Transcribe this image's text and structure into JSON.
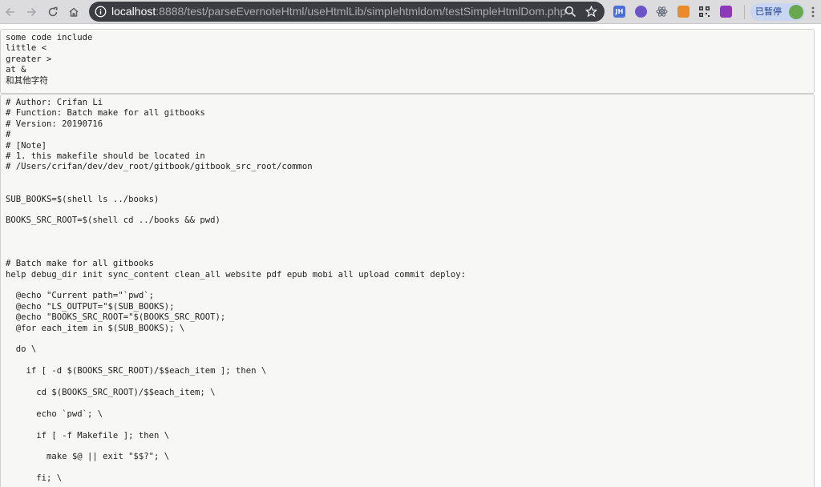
{
  "browser": {
    "url_host": "localhost",
    "url_rest": ":8888/test/parseEvernoteHtml/useHtmlLib/simplehtmldom/testSimpleHtmlDom.php",
    "nav_icons": [
      "back-arrow-icon",
      "forward-arrow-icon",
      "reload-icon",
      "home-icon"
    ],
    "omnibox_icons": [
      "site-info-icon",
      "zoom-search-icon",
      "bookmark-star-icon"
    ],
    "extensions": [
      {
        "name": "jh-extension-icon",
        "label": "JH",
        "color": "#4a6fd6"
      },
      {
        "name": "purple-extension-icon",
        "label": "",
        "color": "#6b53c9"
      },
      {
        "name": "react-devtools-icon",
        "label": "",
        "color": "#5a6270"
      },
      {
        "name": "orange-extension-icon",
        "label": "",
        "color": "#e98b2a"
      },
      {
        "name": "qr-code-icon",
        "label": "",
        "color": "#2f2f2f"
      },
      {
        "name": "php-extension-icon",
        "label": "",
        "color": "#8e3ab8"
      }
    ],
    "profile_label": "已暂停",
    "accent": "#1a73e8"
  },
  "page": {
    "block1": "some code include\nlittle <\ngreater >\nat &\n和其他字符",
    "block2": "# Author: Crifan Li\n# Function: Batch make for all gitbooks\n# Version: 20190716\n#\n# [Note]\n# 1. this makefile should be located in\n# /Users/crifan/dev/dev_root/gitbook/gitbook_src_root/common\n\n\nSUB_BOOKS=$(shell ls ../books)\n\nBOOKS_SRC_ROOT=$(shell cd ../books && pwd)\n\n\n\n# Batch make for all gitbooks\nhelp debug_dir init sync_content clean_all website pdf epub mobi all upload commit deploy:\n\n  @echo \"Current path=\"`pwd`;\n  @echo \"LS_OUTPUT=\"$(SUB_BOOKS);\n  @echo \"BOOKS_SRC_ROOT=\"$(BOOKS_SRC_ROOT);\n  @for each_item in $(SUB_BOOKS); \\\n\n  do \\\n\n    if [ -d $(BOOKS_SRC_ROOT)/$$each_item ]; then \\\n\n      cd $(BOOKS_SRC_ROOT)/$$each_item; \\\n\n      echo `pwd`; \\\n\n      if [ -f Makefile ]; then \\\n\n        make $@ || exit \"$$?\"; \\\n\n      fi; \\"
  }
}
